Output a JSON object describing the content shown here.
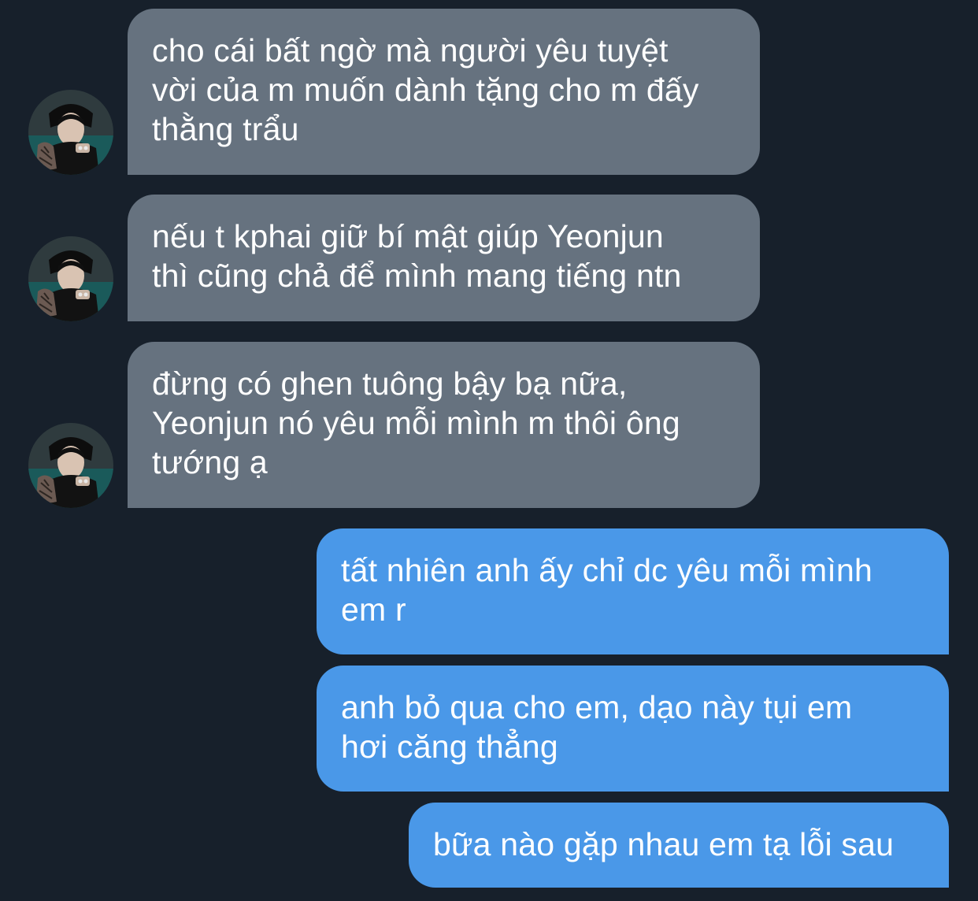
{
  "conversation": {
    "incoming": [
      {
        "lines": [
          "cho cái bất ngờ mà người yêu tuyệt",
          "vời của m muốn dành tặng cho m đấy",
          "thằng trẩu"
        ]
      },
      {
        "lines": [
          "nếu t kphai giữ bí mật giúp Yeonjun",
          "thì cũng chả để mình mang tiếng ntn"
        ]
      },
      {
        "lines": [
          "đừng có ghen tuông bậy bạ nữa,",
          "Yeonjun nó yêu mỗi mình m thôi ông",
          "tướng ạ"
        ]
      }
    ],
    "outgoing": [
      {
        "lines": [
          "tất nhiên anh ấy chỉ dc yêu mỗi mình",
          "em r"
        ]
      },
      {
        "lines": [
          "anh bỏ qua cho em, dạo này tụi em",
          "hơi căng thẳng"
        ]
      },
      {
        "lines": [
          "bữa nào gặp nhau em tạ lỗi sau"
        ]
      }
    ]
  },
  "theme": {
    "background": "#17202b",
    "incoming_bubble": "#66727f",
    "outgoing_bubble": "#4a98e8",
    "text": "#ffffff"
  },
  "icons": {
    "contact_avatar": "contact-avatar-icon"
  }
}
